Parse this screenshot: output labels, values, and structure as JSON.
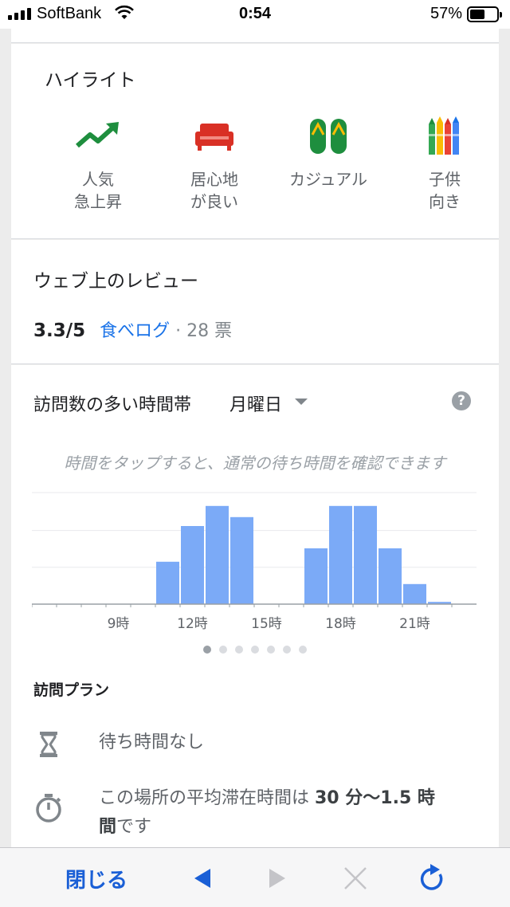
{
  "status_bar": {
    "carrier": "SoftBank",
    "time": "0:54",
    "battery": "57%",
    "battery_level": 0.57
  },
  "highlights": {
    "title": "ハイライト",
    "items": [
      {
        "label": "人気\n急上昇",
        "icon": "trending-up-icon",
        "color": "#1e8e3e"
      },
      {
        "label": "居心地\nが良い",
        "icon": "sofa-icon",
        "color": "#d93025"
      },
      {
        "label": "カジュアル",
        "icon": "sandals-icon",
        "color": "#1e8e3e"
      },
      {
        "label": "子供\n向き",
        "icon": "crayons-icon",
        "color": "#fbbc04"
      }
    ]
  },
  "reviews": {
    "title": "ウェブ上のレビュー",
    "score": "3.3/5",
    "source": "食べログ",
    "votes": " · 28 票"
  },
  "popular_times": {
    "title": "訪問数の多い時間帯",
    "day": "月曜日",
    "help": "?",
    "hint": "時間をタップすると、通常の待ち時間を確認できます"
  },
  "chart_data": {
    "type": "bar",
    "x": [
      6,
      7,
      8,
      9,
      10,
      11,
      12,
      13,
      14,
      15,
      16,
      17,
      18,
      19,
      20,
      21,
      22,
      23
    ],
    "values": [
      0,
      0,
      0,
      0,
      0,
      38,
      70,
      88,
      78,
      0,
      0,
      50,
      88,
      88,
      50,
      18,
      2,
      0
    ],
    "xtick_labels": [
      "9時",
      "12時",
      "15時",
      "18時",
      "21時"
    ],
    "xtick_values": [
      9,
      12,
      15,
      18,
      21
    ],
    "ylim": [
      0,
      100
    ],
    "bar_color": "#7baaf7",
    "grid": true
  },
  "pager": {
    "count": 7,
    "active": 0
  },
  "visit_plan": {
    "title": "訪問プラン",
    "wait_text": "待ち時間なし",
    "stay_prefix": "この場所の平均滞在時間は ",
    "stay_bold1": "30 分〜1.5 時",
    "stay_bold2": "間",
    "stay_suffix": "です"
  },
  "toolbar": {
    "close_label": "閉じる",
    "accent": "#1a5fd6"
  }
}
